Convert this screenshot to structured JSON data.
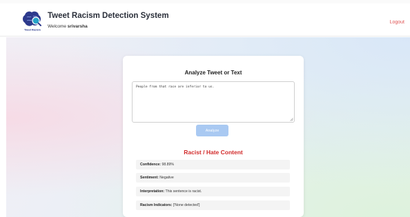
{
  "header": {
    "title": "Tweet Racism Detection System",
    "welcome_prefix": "Welcome",
    "username": "srivarsha",
    "logout_label": "Logout",
    "logo_text": "Tweet Racism"
  },
  "analyzer": {
    "title": "Analyze Tweet or Text",
    "input_value": "People from that race are inferior to us.",
    "analyze_label": "Analyze"
  },
  "result": {
    "heading": "Racist / Hate Content",
    "rows": [
      {
        "label": "Confidence:",
        "value": "98.89%"
      },
      {
        "label": "Sentiment:",
        "value": "Negative"
      },
      {
        "label": "Interpretation:",
        "value": "This sentence is racist."
      },
      {
        "label": "Racism Indicators:",
        "value": "['None detected']"
      }
    ]
  },
  "colors": {
    "accent_red": "#d22b2b",
    "logout": "#e05555",
    "button": "#a9c9f2",
    "logo_navy": "#2d3a8c",
    "logo_teal": "#27a3c8"
  },
  "icons": {
    "logo": "brain-search-icon"
  }
}
